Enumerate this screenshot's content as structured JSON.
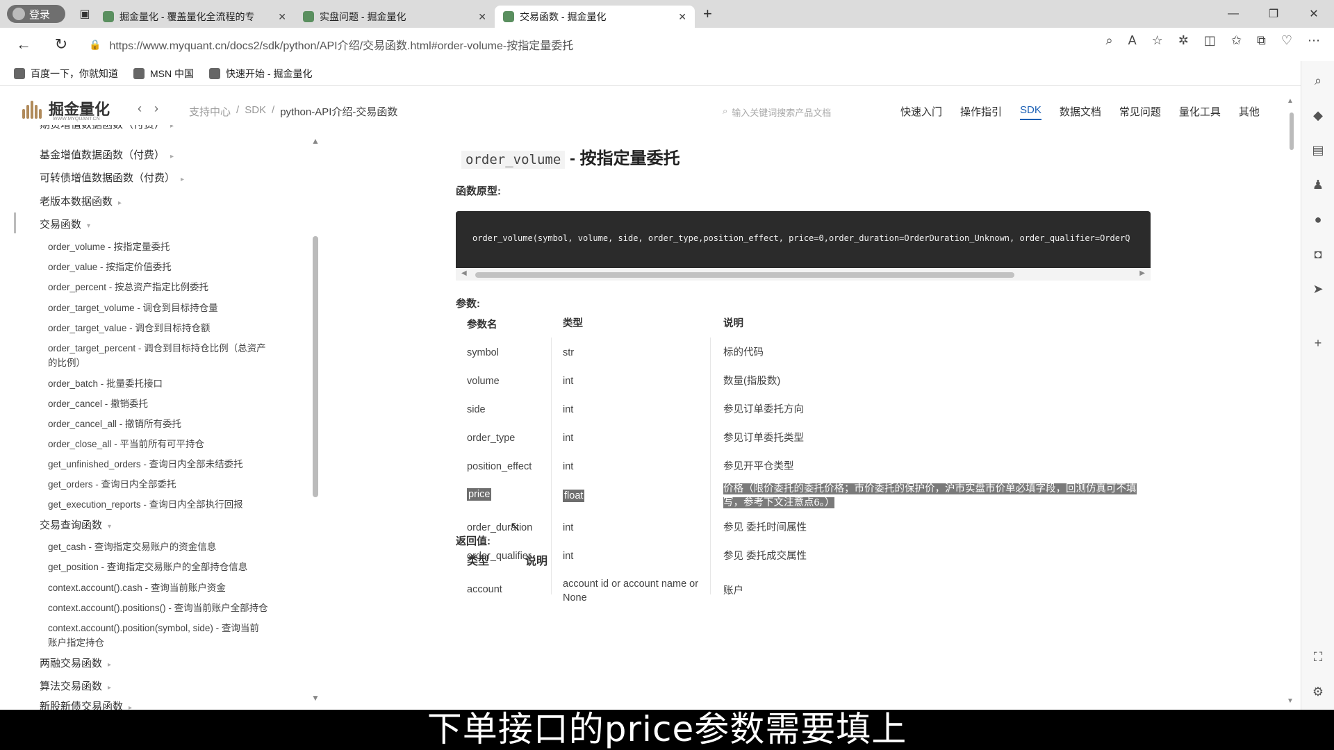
{
  "browser": {
    "login_label": "登录",
    "tabs": [
      {
        "title": "掘金量化 - 覆盖量化全流程的专",
        "active": false
      },
      {
        "title": "实盘问题 - 掘金量化",
        "active": false
      },
      {
        "title": "交易函数 - 掘金量化",
        "active": true
      }
    ],
    "url": "https://www.myquant.cn/docs2/sdk/python/API介绍/交易函数.html#order-volume-按指定量委托",
    "bookmarks": [
      "百度一下，你就知道",
      "MSN 中国",
      "快速开始 - 掘金量化"
    ]
  },
  "site": {
    "logo_text": "掘金量化",
    "logo_sub": "WWW.MYQUANT.CN",
    "breadcrumb": [
      "支持中心",
      "SDK",
      "python-API介绍-交易函数"
    ],
    "search_placeholder": "输入关键词搜索产品文档",
    "nav": [
      {
        "label": "快速入门",
        "active": false
      },
      {
        "label": "操作指引",
        "active": false
      },
      {
        "label": "SDK",
        "active": true
      },
      {
        "label": "数据文档",
        "active": false
      },
      {
        "label": "常见问题",
        "active": false
      },
      {
        "label": "量化工具",
        "active": false
      },
      {
        "label": "其他",
        "active": false
      }
    ]
  },
  "sidebar": {
    "items": [
      {
        "label": "期货增值数据函数（付费）",
        "level": 1
      },
      {
        "label": "基金增值数据函数（付费）",
        "level": 1
      },
      {
        "label": "可转债增值数据函数（付费）",
        "level": 1
      },
      {
        "label": "老版本数据函数",
        "level": 1
      },
      {
        "label": "交易函数",
        "level": 1
      },
      {
        "label": "order_volume - 按指定量委托",
        "level": 2
      },
      {
        "label": "order_value - 按指定价值委托",
        "level": 2
      },
      {
        "label": "order_percent - 按总资产指定比例委托",
        "level": 2
      },
      {
        "label": "order_target_volume - 调仓到目标持仓量",
        "level": 2
      },
      {
        "label": "order_target_value - 调仓到目标持仓额",
        "level": 2
      },
      {
        "label": "order_target_percent - 调仓到目标持仓比例（总资产",
        "level": 2
      },
      {
        "label": "的比例）",
        "level": 2
      },
      {
        "label": "order_batch - 批量委托接口",
        "level": 2
      },
      {
        "label": "order_cancel - 撤销委托",
        "level": 2
      },
      {
        "label": "order_cancel_all - 撤销所有委托",
        "level": 2
      },
      {
        "label": "order_close_all - 平当前所有可平持仓",
        "level": 2
      },
      {
        "label": "get_unfinished_orders - 查询日内全部未结委托",
        "level": 2
      },
      {
        "label": "get_orders - 查询日内全部委托",
        "level": 2
      },
      {
        "label": "get_execution_reports - 查询日内全部执行回报",
        "level": 2
      },
      {
        "label": "交易查询函数",
        "level": 1
      },
      {
        "label": "get_cash - 查询指定交易账户的资金信息",
        "level": 2
      },
      {
        "label": "get_position - 查询指定交易账户的全部持仓信息",
        "level": 2
      },
      {
        "label": "context.account().cash - 查询当前账户资金",
        "level": 2
      },
      {
        "label": "context.account().positions() - 查询当前账户全部持仓",
        "level": 2
      },
      {
        "label": "context.account().position(symbol, side) - 查询当前",
        "level": 2
      },
      {
        "label": "账户指定持仓",
        "level": 2
      },
      {
        "label": "两融交易函数",
        "level": 1
      },
      {
        "label": "算法交易函数",
        "level": 1
      },
      {
        "label": "新股新债交易函数",
        "level": 1
      }
    ]
  },
  "main": {
    "func_name": "order_volume",
    "func_title": " - 按指定量委托",
    "prototype_label": "函数原型:",
    "code": "order_volume(symbol, volume, side, order_type,position_effect, price=0,order_duration=OrderDuration_Unknown, order_qualifier=OrderQ",
    "params_label": "参数:",
    "param_headers": [
      "参数名",
      "类型",
      "说明"
    ],
    "params": [
      {
        "name": "symbol",
        "type": "str",
        "desc": "标的代码"
      },
      {
        "name": "volume",
        "type": "int",
        "desc": "数量(指股数)"
      },
      {
        "name": "side",
        "type": "int",
        "desc": "参见订单委托方向"
      },
      {
        "name": "order_type",
        "type": "int",
        "desc": "参见订单委托类型"
      },
      {
        "name": "position_effect",
        "type": "int",
        "desc": "参见开平仓类型"
      },
      {
        "name": "price",
        "type": "float",
        "desc": "价格（限价委托的委托价格；市价委托的保护价，沪市实盘市价单必填字段，回测仿真可不填写，参考下文注意点6。）"
      },
      {
        "name": "order_duration",
        "type": "int",
        "desc": "参见 委托时间属性"
      },
      {
        "name": "order_qualifier",
        "type": "int",
        "desc": "参见 委托成交属性"
      },
      {
        "name": "account",
        "type": "account id or account name or None",
        "desc": "账户"
      }
    ],
    "return_label": "返回值:",
    "return_headers": [
      "类型",
      "说明"
    ]
  },
  "caption": "下单接口的price参数需要填上"
}
